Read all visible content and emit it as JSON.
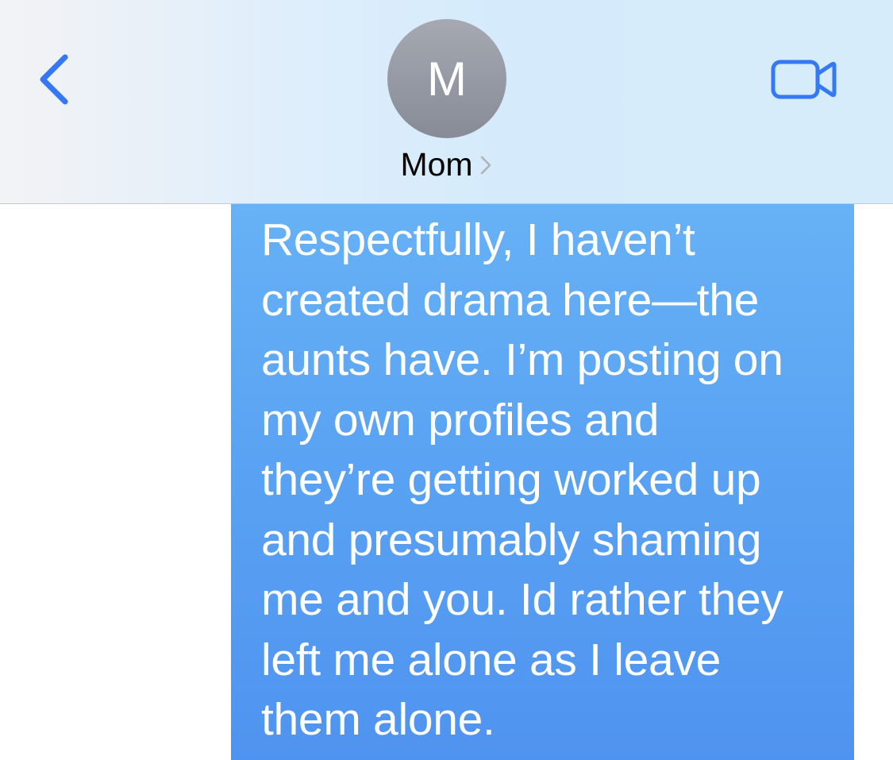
{
  "header": {
    "contact_name": "Mom",
    "avatar_initial": "M",
    "back_icon": "chevron-left-icon",
    "video_icon": "video-camera-icon",
    "disclosure_icon": "chevron-right-icon"
  },
  "messages": [
    {
      "direction": "outgoing",
      "text": "Respectfully, I haven’t\ncreated drama here—the\naunts have. I’m posting on\nmy own profiles and\nthey’re getting worked up\nand presumably shaming\nme and you. Id rather they\nleft me alone as I leave\nthem alone."
    }
  ],
  "colors": {
    "accent": "#3478f6",
    "bubble_top": "#67b1f6",
    "bubble_bottom": "#4f93f0",
    "avatar": "#9a9da7"
  }
}
